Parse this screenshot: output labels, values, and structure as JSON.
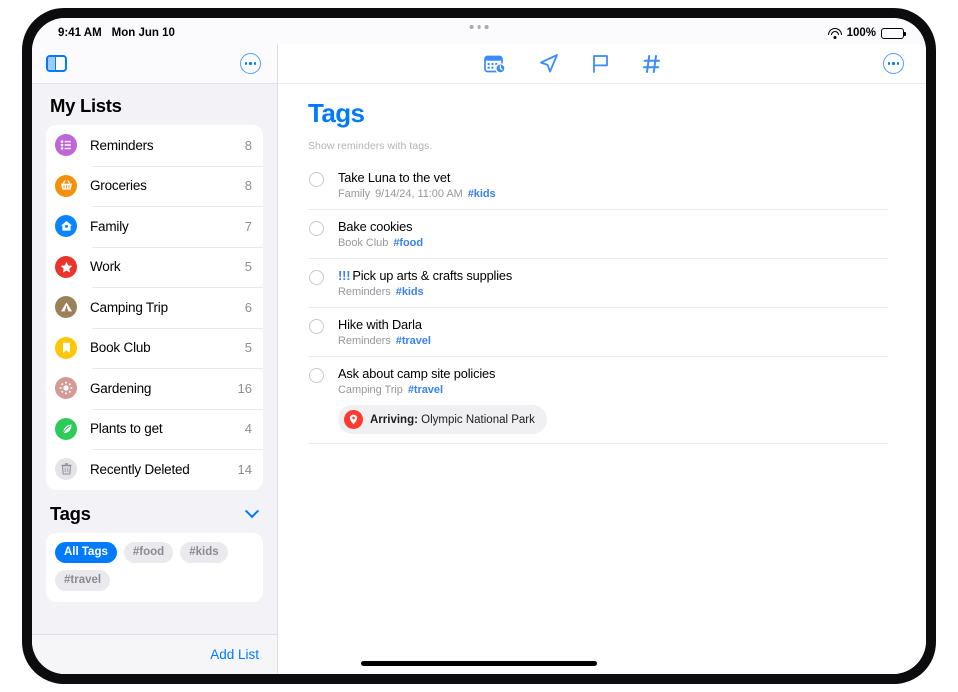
{
  "status_bar": {
    "time": "9:41 AM",
    "date": "Mon Jun 10",
    "wifi_icon": "wifi-icon",
    "battery_percent": "100%",
    "battery_icon": "battery-full-icon"
  },
  "sidebar": {
    "toggle_icon": "sidebar-toggle-icon",
    "more_icon": "more-circle-icon",
    "my_lists_title": "My Lists",
    "lists": [
      {
        "label": "Reminders",
        "count": "8",
        "icon": "list-bullet-icon",
        "color": "#c064dc"
      },
      {
        "label": "Groceries",
        "count": "8",
        "icon": "basket-icon",
        "color": "#f79009"
      },
      {
        "label": "Family",
        "count": "7",
        "icon": "house-icon",
        "color": "#0a84ff"
      },
      {
        "label": "Work",
        "count": "5",
        "icon": "star-icon",
        "color": "#e8342a"
      },
      {
        "label": "Camping Trip",
        "count": "6",
        "icon": "tent-icon",
        "color": "#9b8157"
      },
      {
        "label": "Book Club",
        "count": "5",
        "icon": "bookmark-icon",
        "color": "#fec701"
      },
      {
        "label": "Gardening",
        "count": "16",
        "icon": "sun-flower-icon",
        "color": "#d49a95"
      },
      {
        "label": "Plants to get",
        "count": "4",
        "icon": "leaf-icon",
        "color": "#2ecb5b"
      },
      {
        "label": "Recently Deleted",
        "count": "14",
        "icon": "trash-icon",
        "color": "#e4e4e8"
      }
    ],
    "tags_title": "Tags",
    "tags_collapse_icon": "chevron-down-icon",
    "tag_chips": [
      {
        "label": "All Tags",
        "selected": true
      },
      {
        "label": "#food",
        "selected": false
      },
      {
        "label": "#kids",
        "selected": false
      },
      {
        "label": "#travel",
        "selected": false
      }
    ],
    "add_list_label": "Add List"
  },
  "main": {
    "toolbar_icons": [
      {
        "name": "scheduled-calendar-icon"
      },
      {
        "name": "nearby-location-arrow-icon"
      },
      {
        "name": "flagged-flag-icon"
      },
      {
        "name": "tags-hash-icon"
      }
    ],
    "more_icon": "more-circle-icon",
    "title": "Tags",
    "subtitle": "Show reminders with tags.",
    "reminders": [
      {
        "priority": "",
        "title": "Take Luna to the vet",
        "list": "Family",
        "date": "9/14/24, 11:00 AM",
        "tag": "#kids",
        "location_badge": null
      },
      {
        "priority": "",
        "title": "Bake cookies",
        "list": "Book Club",
        "date": "",
        "tag": "#food",
        "location_badge": null
      },
      {
        "priority": "!!!",
        "title": "Pick up arts & crafts supplies",
        "list": "Reminders",
        "date": "",
        "tag": "#kids",
        "location_badge": null
      },
      {
        "priority": "",
        "title": "Hike with Darla",
        "list": "Reminders",
        "date": "",
        "tag": "#travel",
        "location_badge": null
      },
      {
        "priority": "",
        "title": "Ask about camp site policies",
        "list": "Camping Trip",
        "date": "",
        "tag": "#travel",
        "location_badge": {
          "label": "Arriving:",
          "value": "Olympic National Park",
          "icon": "location-pin-icon"
        }
      }
    ]
  },
  "colors": {
    "accent": "#007aff",
    "tag_blue": "#3b82f6",
    "alert_red": "#ff3b30"
  }
}
